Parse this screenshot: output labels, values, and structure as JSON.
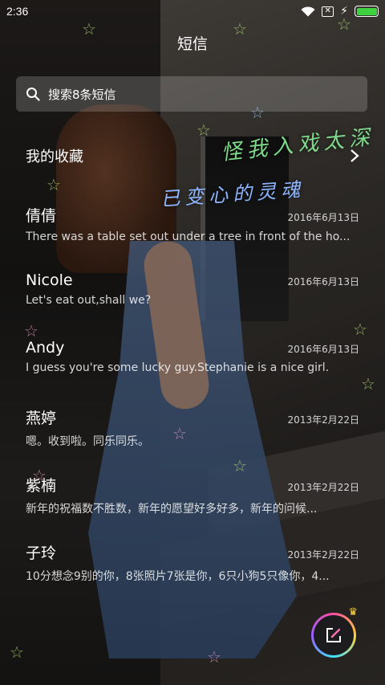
{
  "statusbar": {
    "time": "2:36",
    "sim_icon_glyph": "✕",
    "icons": [
      "wifi-icon",
      "sim-x-icon",
      "charging-bolt-icon",
      "battery-icon"
    ]
  },
  "header": {
    "title": "短信"
  },
  "search": {
    "placeholder": "搜索8条短信",
    "icon": "search-icon"
  },
  "favorites": {
    "label": "我的收藏",
    "icon": "chevron-right-icon"
  },
  "threads": [
    {
      "name": "倩倩",
      "date": "2016年6月13日",
      "preview": "There was a table set out under a tree in front of the ho..."
    },
    {
      "name": "Nicole",
      "date": "2016年6月13日",
      "preview": "Let's eat out,shall we?"
    },
    {
      "name": "Andy",
      "date": "2016年6月13日",
      "preview": "I guess you're some lucky guy.Stephanie is a nice girl."
    },
    {
      "name": "燕婷",
      "date": "2013年2月22日",
      "preview": "嗯。收到啦。同乐同乐。"
    },
    {
      "name": "紫楠",
      "date": "2013年2月22日",
      "preview": "新年的祝福数不胜数，新年的愿望好多好多，新年的问候..."
    },
    {
      "name": "子玲",
      "date": "2013年2月22日",
      "preview": "10分想念9别的你，8张照片7张是你，6只小狗5只像你，4..."
    }
  ],
  "wallpaper_text": {
    "line1": "怪我入戏太深",
    "line2": "已变心的灵魂"
  },
  "compose": {
    "icon": "compose-edit-icon"
  },
  "colors": {
    "battery": "#3ed23e",
    "search_bg": "rgba(255,255,255,0.18)"
  }
}
